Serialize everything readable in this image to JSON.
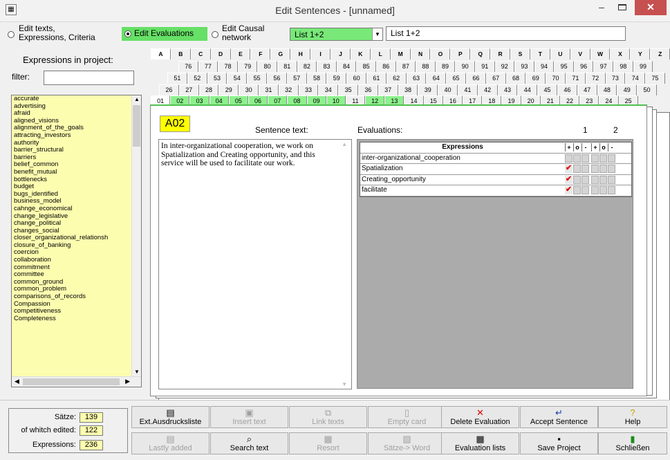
{
  "window": {
    "title": "Edit Sentences - [unnamed]"
  },
  "modes": {
    "edit_texts": "Edit texts, Expressions, Criteria",
    "edit_texts_line1": "Edit texts,",
    "edit_texts_line2": "Expressions, Criteria",
    "edit_evaluations": "Edit Evaluations",
    "edit_causal_line1": "Edit Causal",
    "edit_causal_line2": "network",
    "selected": "Edit Evaluations",
    "list_combo_value": "List 1+2",
    "list_field_value": "List 1+2"
  },
  "left_panel": {
    "title": "Expressions in project:",
    "filter_label": "filter:",
    "filter_value": "",
    "expressions": [
      "accurate",
      "advertising",
      "afraid",
      "aligned_visions",
      "alignment_of_the_goals",
      "attracting_investors",
      "authority",
      "barrier_structural",
      "barriers",
      "belief_common",
      "benefit_mutual",
      "bottlenecks",
      "budget",
      "bugs_identified",
      "business_model",
      "cahnge_economical",
      "change_legislative",
      "change_political",
      "changes_social",
      "closer_organizational_relationsh",
      "closure_of_banking",
      "coercion",
      "collaboration",
      "commitment",
      "committee",
      "common_ground",
      "common_problem",
      "comparisons_of_records",
      "Compassion",
      "competitiveness",
      "Completeness"
    ]
  },
  "tabs": {
    "letters": [
      "A",
      "B",
      "C",
      "D",
      "E",
      "F",
      "G",
      "H",
      "I",
      "J",
      "K",
      "L",
      "M",
      "N",
      "O",
      "P",
      "Q",
      "R",
      "S",
      "T",
      "U",
      "V",
      "W",
      "X",
      "Y",
      "Z"
    ],
    "row_76": [
      "76",
      "77",
      "78",
      "79",
      "80",
      "81",
      "82",
      "83",
      "84",
      "85",
      "86",
      "87",
      "88",
      "89",
      "90",
      "91",
      "92",
      "93",
      "94",
      "95",
      "96",
      "97",
      "98",
      "99"
    ],
    "row_51": [
      "51",
      "52",
      "53",
      "54",
      "55",
      "56",
      "57",
      "58",
      "59",
      "60",
      "61",
      "62",
      "63",
      "64",
      "65",
      "66",
      "67",
      "68",
      "69",
      "70",
      "71",
      "72",
      "73",
      "74",
      "75"
    ],
    "row_26": [
      "26",
      "27",
      "28",
      "29",
      "30",
      "31",
      "32",
      "33",
      "34",
      "35",
      "36",
      "37",
      "38",
      "39",
      "40",
      "41",
      "42",
      "43",
      "44",
      "45",
      "46",
      "47",
      "48",
      "49",
      "50"
    ],
    "row_01": [
      "01",
      "02",
      "03",
      "04",
      "05",
      "06",
      "07",
      "08",
      "09",
      "10",
      "11",
      "12",
      "13",
      "14",
      "15",
      "16",
      "17",
      "18",
      "19",
      "20",
      "21",
      "22",
      "23",
      "24",
      "25"
    ]
  },
  "card": {
    "id": "A02",
    "sentence_label": "Sentence text:",
    "sentence_text": "In inter-organizational cooperation, we work on Spatialization and Creating opportunity, and this service will be used to facilitate our work.",
    "evaluations_label": "Evaluations:",
    "col1": "1",
    "col2": "2",
    "table_header": "Expressions",
    "sign_plus": "+",
    "sign_zero": "o",
    "sign_minus": "-",
    "evaluations": [
      {
        "expression": "inter-organizational_cooperation",
        "checked_plus_1": false
      },
      {
        "expression": "Spatialization",
        "checked_plus_1": true
      },
      {
        "expression": "Creating_opportunity",
        "checked_plus_1": true
      },
      {
        "expression": "facilitate",
        "checked_plus_1": true
      }
    ]
  },
  "stats": {
    "saetze_label": "Sätze:",
    "saetze_value": "139",
    "edited_label": "of whitch edited:",
    "edited_value": "122",
    "expressions_label": "Expressions:",
    "expressions_value": "236"
  },
  "buttons": {
    "ext_list": "Ext.Ausdrucksliste",
    "insert_text": "Insert text",
    "link_texts": "Link texts",
    "empty_card": "Empty card",
    "delete_evaluation": "Delete Evaluation",
    "accept_sentence": "Accept Sentence",
    "help": "Help",
    "lastly_added": "Lastly added",
    "search_text": "Search text",
    "resort": "Resort",
    "saetze_word": "Sätze-> Word",
    "evaluation_lists": "Evaluation lists",
    "save_project": "Save Project",
    "schliessen": "Schließen"
  },
  "colors": {
    "green_highlight": "#66e066",
    "list_yellow": "#fdfdb0",
    "check_red": "#e00000",
    "id_yellow": "#ffff00"
  }
}
